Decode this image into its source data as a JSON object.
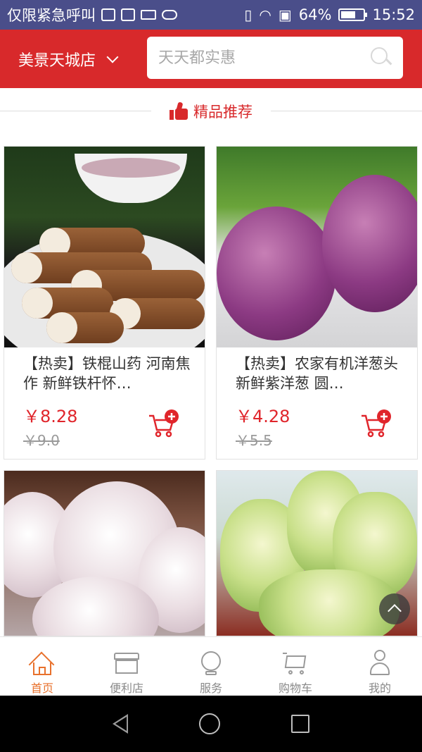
{
  "status_bar": {
    "carrier": "仅限紧急呼叫",
    "battery_percent": "64%",
    "battery_level": 0.64,
    "time": "15:52"
  },
  "header": {
    "store_name": "美景天城店",
    "search_placeholder": "天天都实惠"
  },
  "section": {
    "title": "精品推荐"
  },
  "products": [
    {
      "title": "【热卖】铁棍山药 河南焦作 新鲜铁杆怀…",
      "price": "￥8.28",
      "old_price": "￥9.0",
      "image": "yam"
    },
    {
      "title": "【热卖】农家有机洋葱头 新鲜紫洋葱 圆…",
      "price": "￥4.28",
      "old_price": "￥5.5",
      "image": "red-onion"
    },
    {
      "title": "",
      "price": "",
      "old_price": "",
      "image": "garlic"
    },
    {
      "title": "",
      "price": "",
      "old_price": "",
      "image": "napa-cabbage"
    }
  ],
  "tabs": [
    {
      "label": "首页",
      "icon": "home-icon",
      "active": true
    },
    {
      "label": "便利店",
      "icon": "store-icon",
      "active": false
    },
    {
      "label": "服务",
      "icon": "service-icon",
      "active": false
    },
    {
      "label": "购物车",
      "icon": "cart-icon",
      "active": false
    },
    {
      "label": "我的",
      "icon": "user-icon",
      "active": false
    }
  ],
  "colors": {
    "brand_red": "#d8292b",
    "price_red": "#e0252b",
    "active_tab": "#e8712c",
    "status_bar": "#4a4e8a"
  }
}
